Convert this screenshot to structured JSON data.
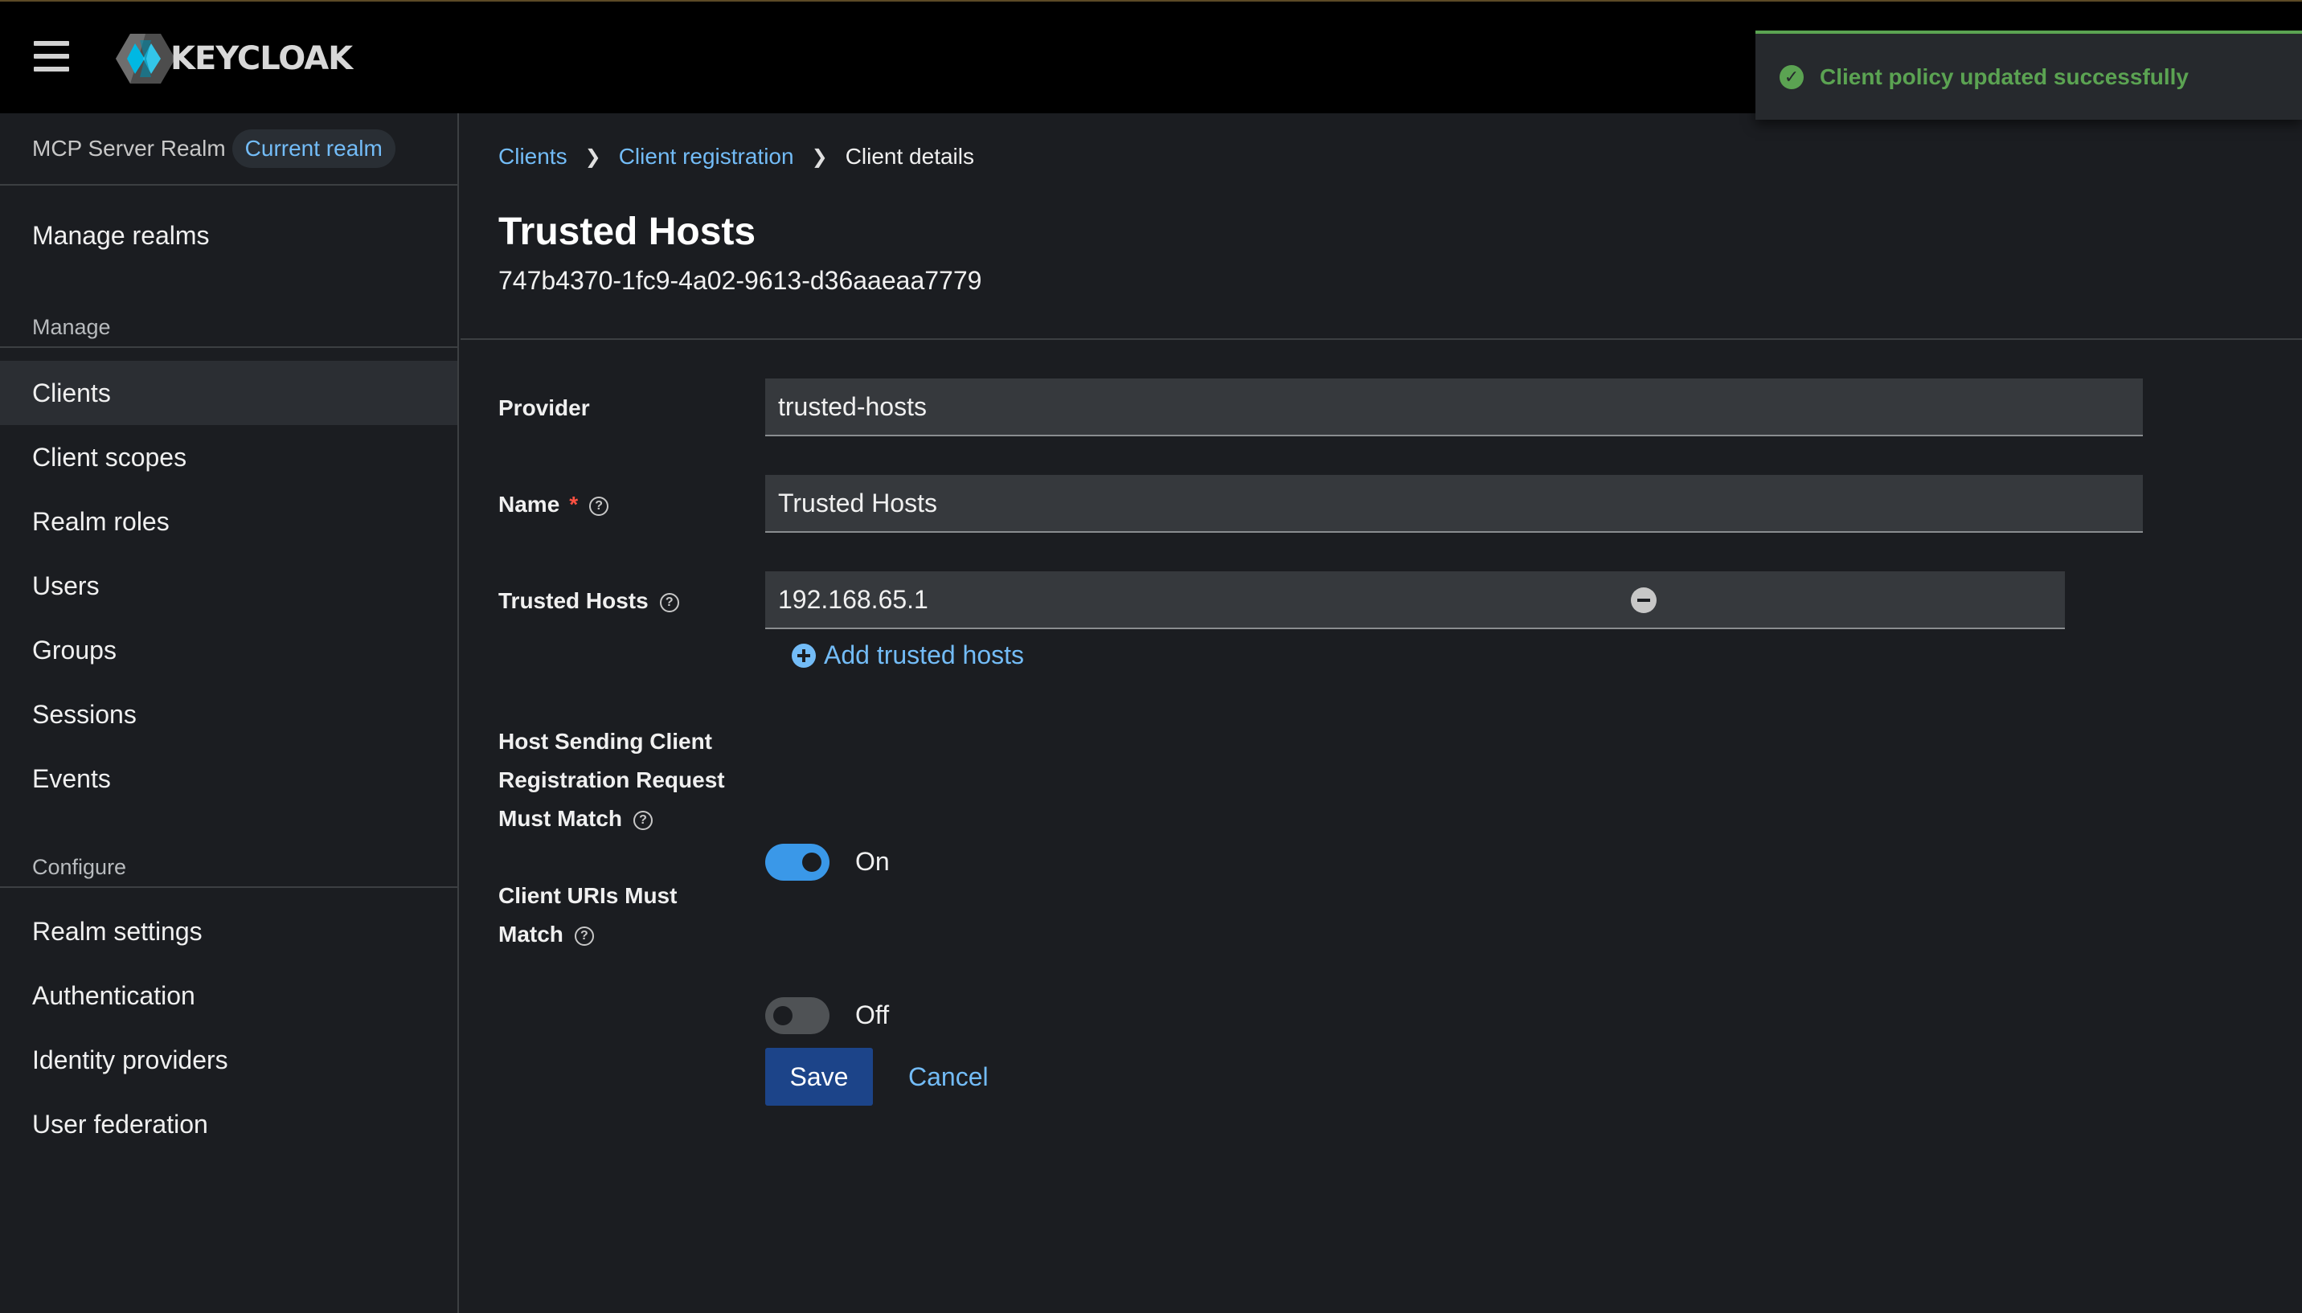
{
  "masthead": {
    "logo_text": "KEYCLOAK",
    "menu_icon": "hamburger-icon"
  },
  "toast": {
    "message": "Client policy updated successfully",
    "icon": "check-circle-icon",
    "color": "#5ba352"
  },
  "sidebar": {
    "realm_name": "MCP Server Realm",
    "realm_badge": "Current realm",
    "manage_realms": "Manage realms",
    "groups": [
      {
        "title": "Manage",
        "items": [
          "Clients",
          "Client scopes",
          "Realm roles",
          "Users",
          "Groups",
          "Sessions",
          "Events"
        ]
      },
      {
        "title": "Configure",
        "items": [
          "Realm settings",
          "Authentication",
          "Identity providers",
          "User federation"
        ]
      }
    ],
    "active_item": "Clients"
  },
  "breadcrumb": {
    "items": [
      "Clients",
      "Client registration"
    ],
    "current": "Client details"
  },
  "page": {
    "title": "Trusted Hosts",
    "subtitle": "747b4370-1fc9-4a02-9613-d36aaeaa7779"
  },
  "form": {
    "provider_label": "Provider",
    "provider_value": "trusted-hosts",
    "name_label": "Name",
    "name_required": "*",
    "name_value": "Trusted Hosts",
    "trusted_hosts_label": "Trusted Hosts",
    "trusted_hosts_value": "192.168.65.1",
    "add_trusted_hosts": "Add trusted hosts",
    "host_sending_label_1": "Host Sending Client",
    "host_sending_label_2": "Registration Request",
    "host_sending_label_3": "Must Match",
    "host_sending_state": "On",
    "client_uris_label_1": "Client URIs Must",
    "client_uris_label_2": "Match",
    "client_uris_state": "Off",
    "save": "Save",
    "cancel": "Cancel"
  },
  "colors": {
    "link": "#73bcf7",
    "primary_button": "#1c4489",
    "switch_on": "#3a98e8",
    "success": "#5ba352"
  }
}
